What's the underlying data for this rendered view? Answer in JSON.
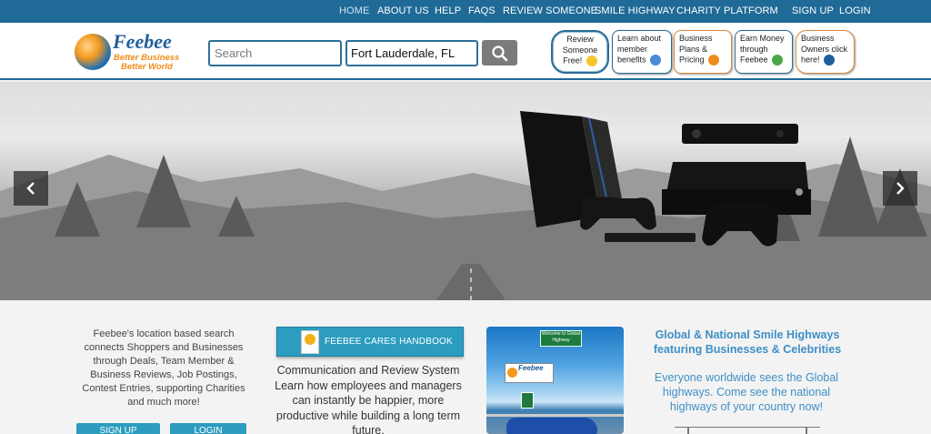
{
  "topnav": {
    "items": [
      {
        "label": "HOME",
        "active": true
      },
      {
        "label": "ABOUT US"
      },
      {
        "label": "HELP"
      },
      {
        "label": "FAQS"
      },
      {
        "label": "REVIEW SOMEONE"
      },
      {
        "label": "SMILE HIGHWAY"
      },
      {
        "label": "CHARITY PLATFORM"
      }
    ],
    "signup": "SIGN UP",
    "login": "LOGIN"
  },
  "logo": {
    "title": "Feebee",
    "tagline1": "Better Business",
    "tagline2": "Better World"
  },
  "search": {
    "placeholder": "Search",
    "location_value": "Fort Lauderdale, FL",
    "button_icon": "search-icon"
  },
  "cta": {
    "review": "Review Someone Free!",
    "learn": "Learn about member benefits",
    "plans": "Business Plans & Pricing",
    "earn": "Earn Money through Feebee",
    "owners": "Business Owners click here!"
  },
  "hero": {
    "prev_icon": "chevron-left-icon",
    "next_icon": "chevron-right-icon"
  },
  "intro": {
    "text": "Feebee's location based search connects Shoppers and Businesses through Deals, Team Member & Business Reviews, Job Postings, Contest Entries, supporting Charities and much more!",
    "signup_button": "SIGN UP",
    "login_button": "LOGIN"
  },
  "handbook": {
    "button_label": "FEEBEE CARES HANDBOOK",
    "text": "Communication and Review System Learn how employees and managers can instantly be happier, more productive while building a long term future."
  },
  "highway_image": {
    "sign_text": "Welcome to Global Highway",
    "sign_logo": "Feebee"
  },
  "global": {
    "title": "Global & National Smile Highways featuring Businesses & Celebrities",
    "text": "Everyone worldwide sees the Global highways. Come see the national highways of your country now!"
  },
  "colors": {
    "nav_blue": "#1f6a97",
    "accent_orange": "#f08c1a",
    "teal": "#2c9dbf",
    "link_blue": "#3f8fc6"
  }
}
